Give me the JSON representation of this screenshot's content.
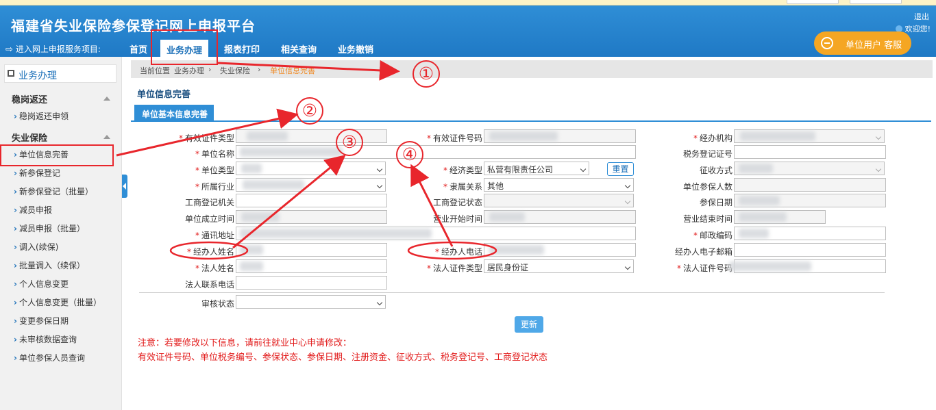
{
  "header": {
    "title": "福建省失业保险参保登记网上申报平台",
    "logout": "退出",
    "welcome": "欢迎您!",
    "customer_service": "单位用户 客服"
  },
  "nav": {
    "entry": "进入网上申报服务项目:",
    "items": [
      "首页",
      "业务办理",
      "报表打印",
      "相关查询",
      "业务撤销"
    ]
  },
  "sidebar": {
    "head": "业务办理",
    "group1": "稳岗返还",
    "group1_items": [
      "稳岗返还申领"
    ],
    "group2": "失业保险",
    "group2_items": [
      "单位信息完善",
      "新参保登记",
      "新参保登记（批量）",
      "减员申报",
      "减员申报（批量）",
      "调入(续保)",
      "批量调入（续保）",
      "个人信息变更",
      "个人信息变更（批量）",
      "变更参保日期",
      "未审核数据查询",
      "单位参保人员查询"
    ]
  },
  "breadcrumb": [
    "当前位置",
    "业务办理",
    "失业保险",
    "单位信息完善"
  ],
  "section_title": "单位信息完善",
  "tab": "单位基本信息完善",
  "form": {
    "f1": "有效证件类型",
    "f2": "有效证件号码",
    "f3": "经办机构",
    "f4": "单位名称",
    "f5": "税务登记证号",
    "f6": "单位类型",
    "f7": "经济类型",
    "f7_value": "私营有限责任公司",
    "f8": "征收方式",
    "f9": "所属行业",
    "f10": "隶属关系",
    "f10_value": "其他",
    "f11": "单位参保人数",
    "f12": "工商登记机关",
    "f13": "工商登记状态",
    "f14": "参保日期",
    "f15": "单位成立时间",
    "f16": "营业开始时间",
    "f17": "营业结束时间",
    "f18": "通讯地址",
    "f19": "邮政编码",
    "f20": "经办人姓名",
    "f21": "经办人电话",
    "f22": "经办人电子邮箱",
    "f23": "法人姓名",
    "f24": "法人证件类型",
    "f24_value": "居民身份证",
    "f25": "法人证件号码",
    "f26": "法人联系电话",
    "f27": "审核状态"
  },
  "buttons": {
    "reset": "重置",
    "update": "更新"
  },
  "notes": {
    "line1": "注意：若要修改以下信息，请前往就业中心申请修改：",
    "line2": "有效证件号码、单位税务编号、参保状态、参保日期、注册资金、征收方式、税务登记号、工商登记状态"
  },
  "annotations": [
    "①",
    "②",
    "③",
    "④"
  ],
  "colors": {
    "brand_blue": "#2f8ed6",
    "accent_orange": "#f5a623",
    "annotation_red": "#e8262c",
    "note_red": "#e21b1b"
  }
}
